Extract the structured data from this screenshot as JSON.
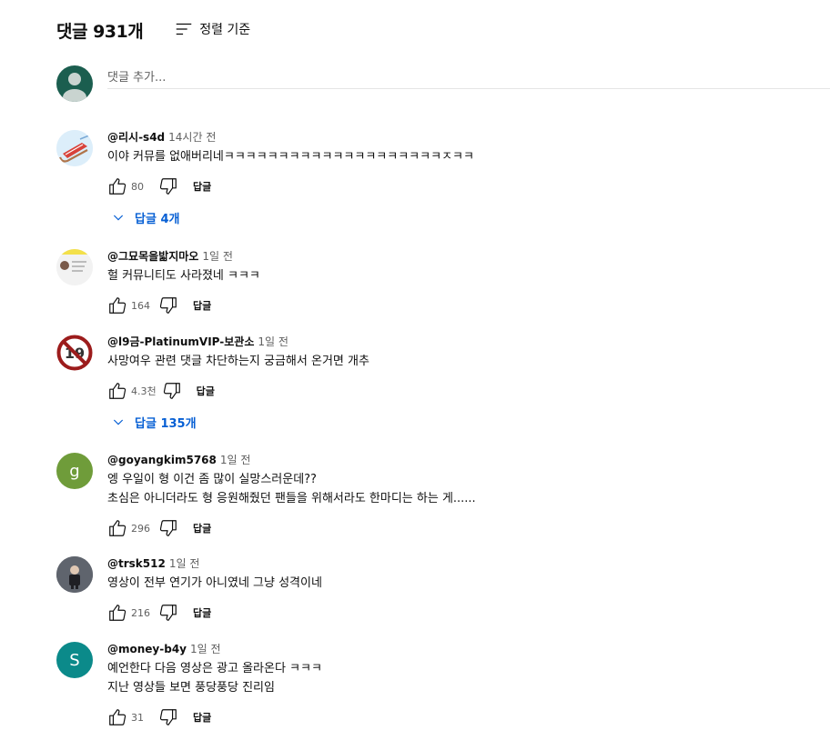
{
  "header": {
    "count": "댓글 931개",
    "sort_label": "정렬 기준"
  },
  "add_comment": {
    "placeholder": "댓글 추가..."
  },
  "reply_label": "답글",
  "colors": {
    "reply_link": "#065fd4",
    "avatar_green": "#6f9c3a",
    "avatar_teal": "#0b8a8a"
  },
  "comments": [
    {
      "author": "@리시-s4d",
      "time": "14시간 전",
      "text": "이야 커뮤를 없애버리네ㅋㅋㅋㅋㅋㅋㅋㅋㅋㅋㅋㅋㅋㅋㅋㅋㅋㅋㅋㅋㅈㅋㅋ",
      "likes": "80",
      "replies": "답글 4개"
    },
    {
      "author": "@그묘목을밟지마오",
      "time": "1일 전",
      "text": "헐 커뮤니티도 사라졌네 ㅋㅋㅋ",
      "likes": "164"
    },
    {
      "author": "@l9금-PlatinumVIP-보관소",
      "time": "1일 전",
      "text": "사망여우 관련 댓글 차단하는지 궁금해서 온거면 개추",
      "likes": "4.3천",
      "replies": "답글 135개",
      "avatar_text": "19"
    },
    {
      "author": "@goyangkim5768",
      "time": "1일 전",
      "text": "엥 우일이 형 이건 좀 많이 실망스러운데??\n초심은 아니더라도 형 응원해줬던 팬들을 위해서라도 한마디는 하는 게......",
      "likes": "296",
      "avatar_letter": "g"
    },
    {
      "author": "@trsk512",
      "time": "1일 전",
      "text": "영상이 전부 연기가 아니였네 그냥 성격이네",
      "likes": "216"
    },
    {
      "author": "@money-b4y",
      "time": "1일 전",
      "text": "예언한다 다음 영상은 광고 올라온다 ㅋㅋㅋ\n지난 영상들 보면 풍당풍당 진리임",
      "likes": "31",
      "avatar_letter": "S"
    }
  ]
}
